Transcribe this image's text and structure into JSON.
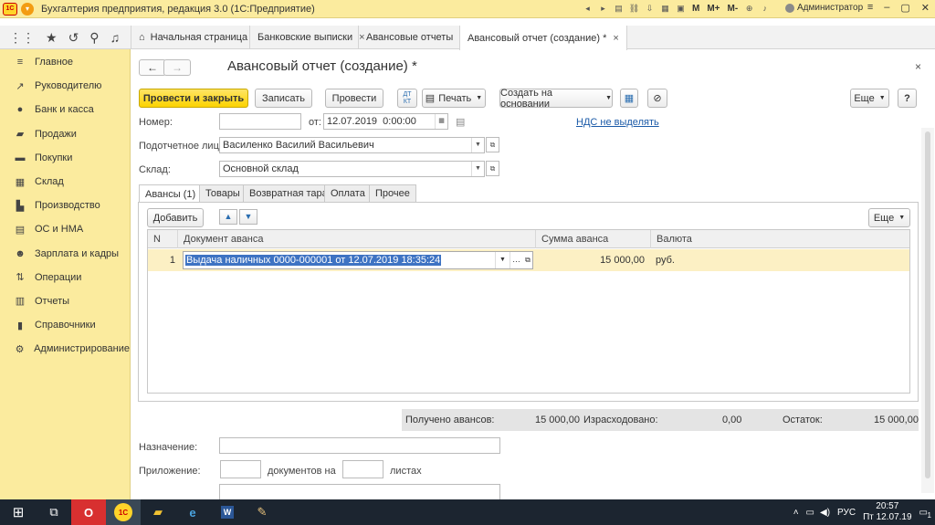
{
  "window": {
    "title": "Бухгалтерия предприятия, редакция 3.0  (1С:Предприятие)",
    "user": "Администратор",
    "memory_buttons": [
      "M",
      "M+",
      "M-"
    ]
  },
  "tabs": [
    {
      "label": "Начальная страница"
    },
    {
      "label": "Банковские выписки",
      "closable": true
    },
    {
      "label": "Авансовые отчеты",
      "closable": true
    },
    {
      "label": "Авансовый отчет (создание) *",
      "closable": true,
      "active": true
    }
  ],
  "sidebar": {
    "items": [
      {
        "label": "Главное",
        "icon": "menu-icon"
      },
      {
        "label": "Руководителю",
        "icon": "trend-icon"
      },
      {
        "label": "Банк и касса",
        "icon": "coin-icon"
      },
      {
        "label": "Продажи",
        "icon": "bag-icon"
      },
      {
        "label": "Покупки",
        "icon": "cart-icon"
      },
      {
        "label": "Склад",
        "icon": "box-icon"
      },
      {
        "label": "Производство",
        "icon": "factory-icon"
      },
      {
        "label": "ОС и НМА",
        "icon": "asset-icon"
      },
      {
        "label": "Зарплата и кадры",
        "icon": "people-icon"
      },
      {
        "label": "Операции",
        "icon": "operations-icon"
      },
      {
        "label": "Отчеты",
        "icon": "chart-icon"
      },
      {
        "label": "Справочники",
        "icon": "book-icon"
      },
      {
        "label": "Администрирование",
        "icon": "gear-icon"
      }
    ]
  },
  "document": {
    "title": "Авансовый отчет (создание) *"
  },
  "toolbar": {
    "post_close": "Провести и закрыть",
    "save": "Записать",
    "post": "Провести",
    "dtkt": "ДТ КТ",
    "print": "Печать",
    "create_based": "Создать на основании",
    "more": "Еще",
    "help": "?"
  },
  "form": {
    "number_label": "Номер:",
    "number_value": "",
    "from_label": "от:",
    "date_value": "12.07.2019  0:00:00",
    "vat_link": "НДС не выделять",
    "person_label": "Подотчетное лицо:",
    "person_value": "Василенко Василий Васильевич",
    "warehouse_label": "Склад:",
    "warehouse_value": "Основной склад"
  },
  "inner_tabs": [
    "Авансы (1)",
    "Товары",
    "Возвратная тара",
    "Оплата",
    "Прочее"
  ],
  "table_toolbar": {
    "add": "Добавить",
    "more": "Еще"
  },
  "table": {
    "columns": [
      "N",
      "Документ аванса",
      "Сумма аванса",
      "Валюта"
    ],
    "rows": [
      {
        "n": "1",
        "doc": "Выдача наличных 0000-000001 от 12.07.2019 18:35:24",
        "sum": "15 000,00",
        "currency": "руб."
      }
    ]
  },
  "totals": {
    "received_label": "Получено авансов:",
    "received_value": "15 000,00",
    "spent_label": "Израсходовано:",
    "spent_value": "0,00",
    "balance_label": "Остаток:",
    "balance_value": "15 000,00"
  },
  "bottom": {
    "purpose_label": "Назначение:",
    "attachment_label": "Приложение:",
    "docs_on_label": "документов на",
    "sheets_label": "листах"
  },
  "taskbar": {
    "lang": "РУС",
    "time": "20:57",
    "date": "Пт 12.07.19",
    "notification_count": "1"
  },
  "colors": {
    "accent_yellow": "#fcd300",
    "sidebar_bg": "#fbeb9e",
    "selection_blue": "#3e73c3",
    "link_blue": "#1c5ba8"
  }
}
